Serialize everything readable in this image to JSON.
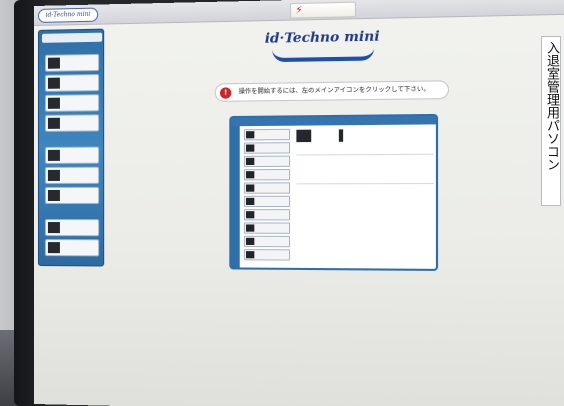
{
  "window": {
    "logo_small": "id-Techno mini",
    "top_menu": [
      "",
      "",
      ""
    ],
    "alert_label": "",
    "alert_icon": "lightning-icon"
  },
  "sidebar": {
    "top_text": "",
    "sections": [
      "",
      "",
      ""
    ],
    "items": [
      {
        "label": "",
        "icon": "person-icon"
      },
      {
        "label": "",
        "icon": "card-icon"
      },
      {
        "label": "",
        "icon": "card-icon"
      },
      {
        "label": "",
        "icon": "card-icon"
      },
      {
        "label": "",
        "icon": "list-icon"
      },
      {
        "label": "",
        "icon": "list-icon"
      },
      {
        "label": "",
        "icon": "gear-icon"
      },
      {
        "label": "",
        "icon": "network-icon"
      },
      {
        "label": "",
        "icon": "building-icon"
      }
    ]
  },
  "main": {
    "brand": "id·Techno mini",
    "notice": "操作を開始するには、左のメインアイコンをクリックして下さい。",
    "notice_icon": "alert-icon"
  },
  "panel": {
    "header": "",
    "side_text": "",
    "buttons": [
      "",
      "",
      "",
      "",
      "",
      "",
      "",
      "",
      "",
      "",
      ""
    ],
    "desc_title": "",
    "desc_sub1": "",
    "desc_sub2": ""
  },
  "sticker": {
    "text": "入退室管理用パソコン"
  },
  "colors": {
    "sidebar_blue": "#3e86bf",
    "brand_blue": "#1e3a8a",
    "alert_red": "#c31b1b"
  }
}
